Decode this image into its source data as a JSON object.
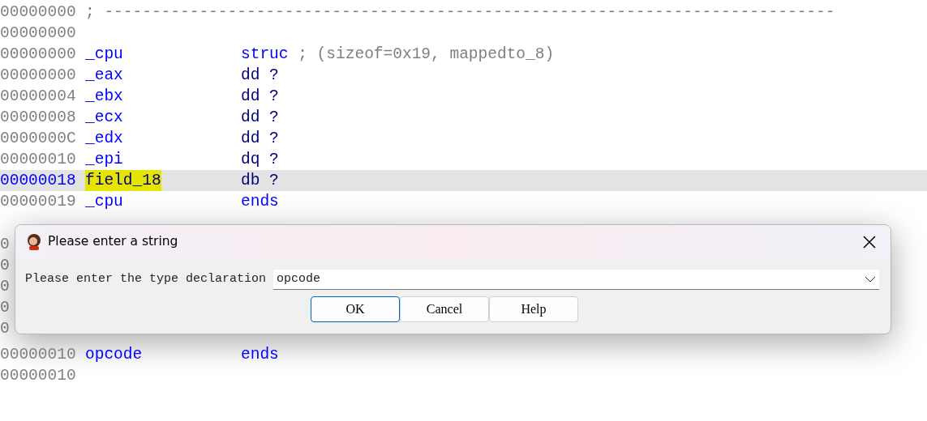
{
  "listing": {
    "rows": [
      {
        "address": "00000000",
        "selected": false,
        "comment": "; -----------------------------------------------------------------------------"
      },
      {
        "address": "00000000",
        "selected": false
      },
      {
        "address": "00000000",
        "selected": false,
        "name": "_cpu",
        "type": "struc",
        "kind": "directive",
        "comment": "; (sizeof=0x19, mappedto_8)"
      },
      {
        "address": "00000000",
        "selected": false,
        "name": "_eax",
        "type": "dd ?",
        "kind": "member"
      },
      {
        "address": "00000004",
        "selected": false,
        "name": "_ebx",
        "type": "dd ?",
        "kind": "member"
      },
      {
        "address": "00000008",
        "selected": false,
        "name": "_ecx",
        "type": "dd ?",
        "kind": "member"
      },
      {
        "address": "0000000C",
        "selected": false,
        "name": "_edx",
        "type": "dd ?",
        "kind": "member"
      },
      {
        "address": "00000010",
        "selected": false,
        "name": "_epi",
        "type": "dq ?",
        "kind": "member"
      },
      {
        "address": "00000018",
        "selected": true,
        "name": "field_18",
        "type": "db ?",
        "kind": "member"
      },
      {
        "address": "00000019",
        "selected": false,
        "name": "_cpu",
        "type": "ends",
        "kind": "directive"
      }
    ],
    "rows_below": [
      {
        "address": "00000010",
        "selected": false,
        "name": "opcode",
        "type": "ends",
        "kind": "directive"
      },
      {
        "address": "00000010",
        "selected": false
      }
    ],
    "covered_rows": [
      {
        "address": "0"
      },
      {
        "address": "0"
      },
      {
        "address": "0"
      },
      {
        "address": "0"
      },
      {
        "address": "0"
      }
    ]
  },
  "dialog": {
    "title": "Please enter a string",
    "label": "Please enter the type declaration",
    "value": "opcode",
    "buttons": [
      {
        "label": "OK",
        "default": true
      },
      {
        "label": "Cancel",
        "default": false
      },
      {
        "label": "Help",
        "default": false
      }
    ]
  }
}
